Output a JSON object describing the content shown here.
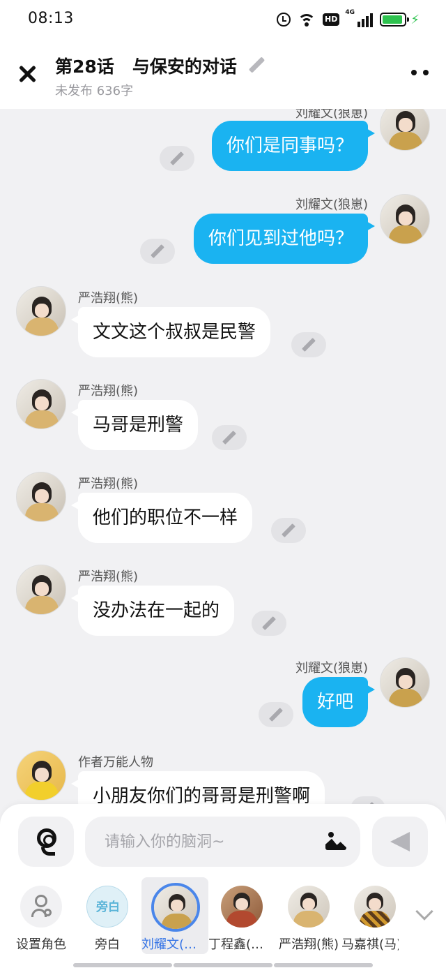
{
  "status_bar": {
    "time": "08:13",
    "network": "4G",
    "hd": "HD"
  },
  "header": {
    "title": "第28话   与保安的对话",
    "subtitle": "未发布 636字"
  },
  "messages": [
    {
      "side": "right",
      "name": "刘耀文(狼崽)",
      "text": "你们是同事吗？"
    },
    {
      "side": "right",
      "name": "刘耀文(狼崽)",
      "text": "你们见到过他吗？"
    },
    {
      "side": "left",
      "name": "严浩翔(熊)",
      "text": "文文这个叔叔是民警"
    },
    {
      "side": "left",
      "name": "严浩翔(熊)",
      "text": "马哥是刑警"
    },
    {
      "side": "left",
      "name": "严浩翔(熊)",
      "text": "他们的职位不一样"
    },
    {
      "side": "left",
      "name": "严浩翔(熊)",
      "text": "没办法在一起的"
    },
    {
      "side": "right",
      "name": "刘耀文(狼崽)",
      "text": "好吧"
    },
    {
      "side": "left",
      "name": "作者万能人物",
      "text": "小朋友你们的哥哥是刑警啊"
    }
  ],
  "composer": {
    "placeholder": "请输入你的脑洞~"
  },
  "roles": [
    {
      "label": "设置角色"
    },
    {
      "label": "旁白",
      "avatar_text": "旁白"
    },
    {
      "label": "刘耀文(狼崽)",
      "selected": true
    },
    {
      "label": "丁程鑫(狐狸)"
    },
    {
      "label": "严浩翔(熊)"
    },
    {
      "label": "马嘉祺(马)"
    }
  ],
  "colors": {
    "accent": "#1ab3f1",
    "selected_role": "#3574e6",
    "battery": "#2ec24f"
  }
}
